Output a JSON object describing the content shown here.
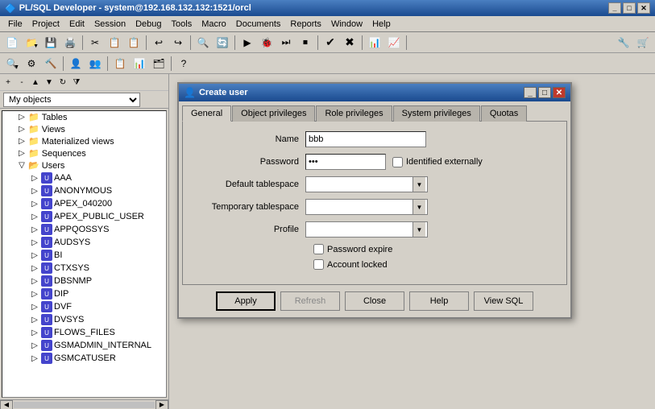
{
  "titlebar": {
    "title": "PL/SQL Developer - system@192.168.132.132:1521/orcl",
    "icon": "🔷"
  },
  "menubar": {
    "items": [
      "File",
      "Project",
      "Edit",
      "Session",
      "Debug",
      "Tools",
      "Macro",
      "Documents",
      "Reports",
      "Window",
      "Help"
    ]
  },
  "toolbar": {
    "buttons": [
      "📄",
      "📁",
      "💾",
      "🖨️",
      "✂️",
      "📋",
      "📋",
      "↩️",
      "↪️",
      "🔍",
      "🔄"
    ]
  },
  "leftpanel": {
    "title": "My objects",
    "tree": {
      "items": [
        {
          "label": "Tables",
          "level": 1,
          "expanded": true,
          "type": "folder"
        },
        {
          "label": "Views",
          "level": 1,
          "expanded": false,
          "type": "folder"
        },
        {
          "label": "Materialized views",
          "level": 1,
          "expanded": false,
          "type": "folder"
        },
        {
          "label": "Sequences",
          "level": 1,
          "expanded": false,
          "type": "folder"
        },
        {
          "label": "Users",
          "level": 1,
          "expanded": true,
          "type": "folder"
        },
        {
          "label": "AAA",
          "level": 2,
          "type": "user"
        },
        {
          "label": "ANONYMOUS",
          "level": 2,
          "type": "user"
        },
        {
          "label": "APEX_040200",
          "level": 2,
          "type": "user"
        },
        {
          "label": "APEX_PUBLIC_USER",
          "level": 2,
          "type": "user"
        },
        {
          "label": "APPQOSSYS",
          "level": 2,
          "type": "user"
        },
        {
          "label": "AUDSYS",
          "level": 2,
          "type": "user"
        },
        {
          "label": "BI",
          "level": 2,
          "type": "user"
        },
        {
          "label": "CTXSYS",
          "level": 2,
          "type": "user"
        },
        {
          "label": "DBSNMP",
          "level": 2,
          "type": "user"
        },
        {
          "label": "DIP",
          "level": 2,
          "type": "user"
        },
        {
          "label": "DVF",
          "level": 2,
          "type": "user"
        },
        {
          "label": "DVSYS",
          "level": 2,
          "type": "user"
        },
        {
          "label": "FLOWS_FILES",
          "level": 2,
          "type": "user"
        },
        {
          "label": "GSMADMIN_INTERNAL",
          "level": 2,
          "type": "user"
        },
        {
          "label": "GSMCATUSER",
          "level": 2,
          "type": "user"
        }
      ]
    }
  },
  "dialog": {
    "title": "Create user",
    "tabs": [
      "General",
      "Object privileges",
      "Role privileges",
      "System privileges",
      "Quotas"
    ],
    "active_tab": "General",
    "form": {
      "name_label": "Name",
      "name_value": "bbb",
      "password_label": "Password",
      "password_value": "***",
      "identified_externally_label": "Identified externally",
      "default_tablespace_label": "Default tablespace",
      "default_tablespace_value": "",
      "temporary_tablespace_label": "Temporary tablespace",
      "temporary_tablespace_value": "",
      "profile_label": "Profile",
      "profile_value": "",
      "password_expire_label": "Password expire",
      "account_locked_label": "Account locked"
    },
    "buttons": {
      "apply": "Apply",
      "refresh": "Refresh",
      "close": "Close",
      "help": "Help",
      "view_sql": "View SQL"
    }
  }
}
